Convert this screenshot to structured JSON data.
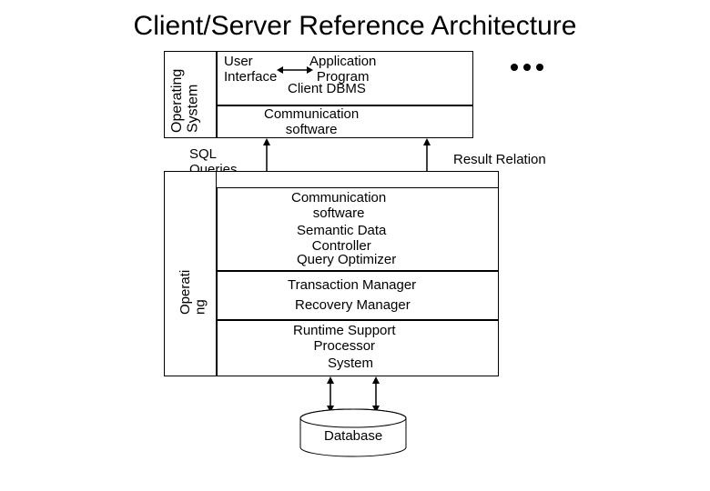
{
  "title": "Client/Server Reference Architecture",
  "client": {
    "os_label": "Operating\nSystem",
    "ui_label": "User\nInterface",
    "app_label": "Application\nProgram",
    "dbms_label": "Client DBMS",
    "comm_label": "Communication\nsoftware"
  },
  "labels": {
    "sql": "SQL\nQueries",
    "result": "Result Relation"
  },
  "server": {
    "os_label": "Operati\nng",
    "comm": "Communication\nsoftware",
    "semantic": "Semantic Data\nController",
    "optimizer": "Query Optimizer",
    "txn": "Transaction Manager",
    "recovery": "Recovery Manager",
    "runtime": "Runtime Support\nProcessor",
    "system": "System"
  },
  "db": "Database"
}
